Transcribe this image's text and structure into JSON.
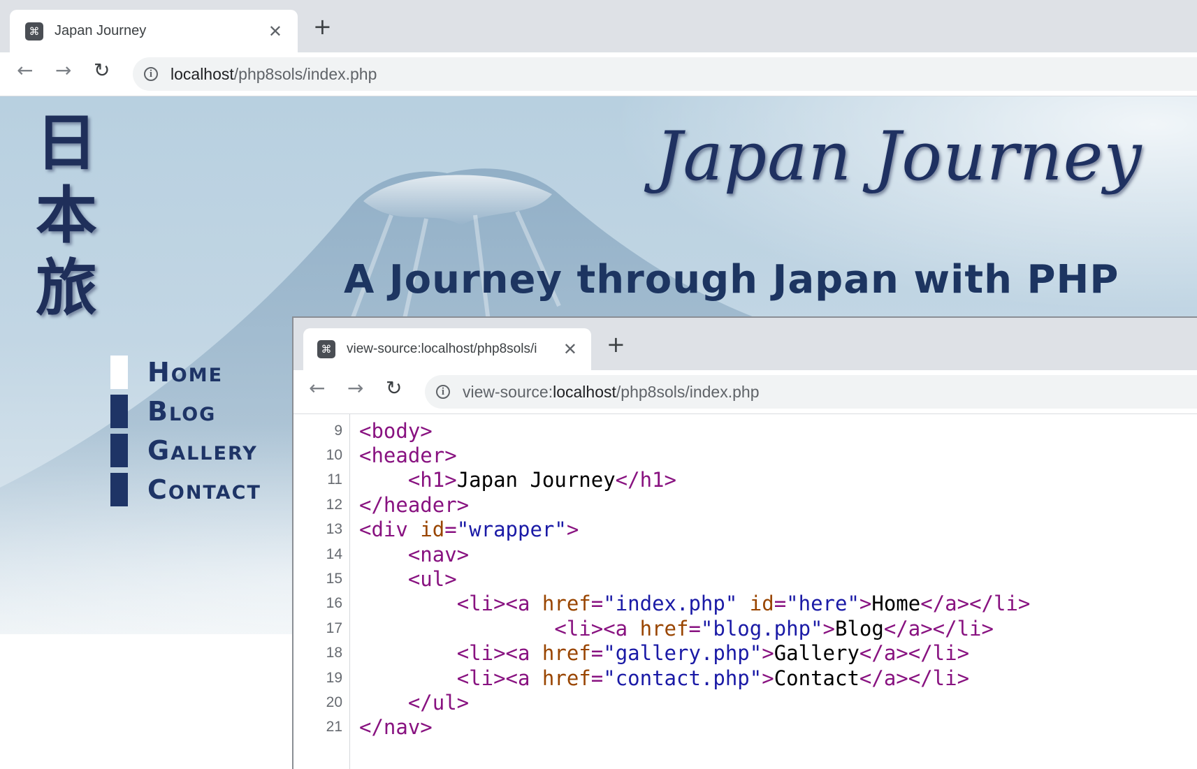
{
  "browser": {
    "tab": {
      "title": "Japan Journey",
      "close": "✕"
    },
    "new_tab": "+",
    "nav": {
      "back": "←",
      "forward": "→",
      "reload": "↻"
    },
    "address": {
      "info": "i",
      "host": "localhost",
      "path": "/php8sols/index.php"
    }
  },
  "page": {
    "kanji": [
      "日",
      "本",
      "旅"
    ],
    "title": "Japan Journey",
    "tagline": "A Journey through Japan with PHP",
    "nav_items": [
      {
        "label": "Home",
        "active": true
      },
      {
        "label": "Blog",
        "active": false
      },
      {
        "label": "Gallery",
        "active": false
      },
      {
        "label": "Contact",
        "active": false
      }
    ]
  },
  "source_window": {
    "tab": {
      "title": "view-source:localhost/php8sols/i",
      "close": "✕"
    },
    "new_tab": "+",
    "address": {
      "info": "i",
      "scheme": "view-source:",
      "host": "localhost",
      "path": "/php8sols/index.php"
    },
    "lines": [
      {
        "n": "9",
        "code": "<body>"
      },
      {
        "n": "10",
        "code": "<header>"
      },
      {
        "n": "11",
        "code": "    <h1>Japan Journey</h1>"
      },
      {
        "n": "12",
        "code": "</header>"
      },
      {
        "n": "13",
        "code": "<div id=\"wrapper\">"
      },
      {
        "n": "14",
        "code": "    <nav>"
      },
      {
        "n": "15",
        "code": "    <ul>"
      },
      {
        "n": "16",
        "code": "        <li><a href=\"index.php\" id=\"here\">Home</a></li>"
      },
      {
        "n": "17",
        "code": "                <li><a href=\"blog.php\">Blog</a></li>"
      },
      {
        "n": "18",
        "code": "        <li><a href=\"gallery.php\">Gallery</a></li>"
      },
      {
        "n": "19",
        "code": "        <li><a href=\"contact.php\">Contact</a></li>"
      },
      {
        "n": "20",
        "code": "    </ul>"
      },
      {
        "n": "21",
        "code": "</nav>"
      }
    ]
  },
  "colors": {
    "navy": "#1e3466",
    "active_marker": "#ffffff"
  }
}
